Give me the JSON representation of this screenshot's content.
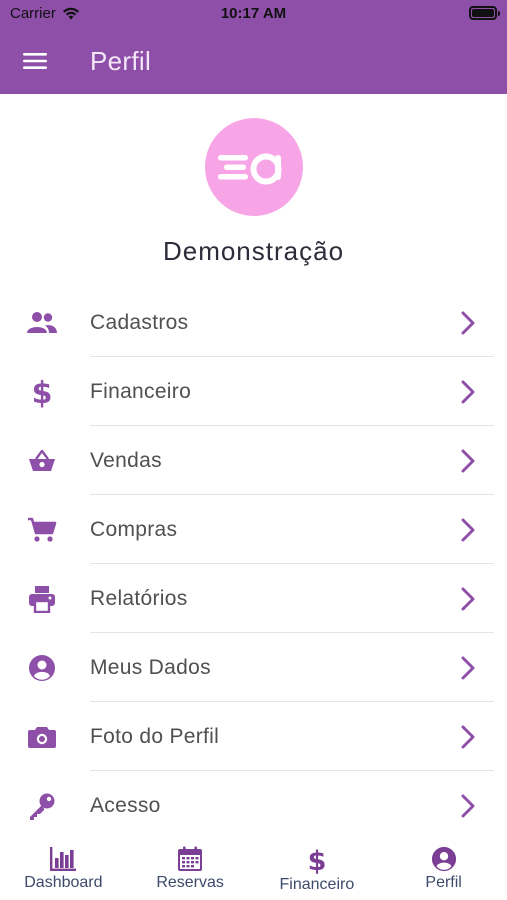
{
  "status_bar": {
    "carrier": "Carrier",
    "time": "10:17 AM"
  },
  "header": {
    "title": "Perfil",
    "menu_icon": "hamburger-icon"
  },
  "profile": {
    "name": "Demonstração",
    "logo_icon": "ea-logo"
  },
  "menu": {
    "items": [
      {
        "label": "Cadastros",
        "icon": "people-icon"
      },
      {
        "label": "Financeiro",
        "icon": "dollar-icon"
      },
      {
        "label": "Vendas",
        "icon": "basket-icon"
      },
      {
        "label": "Compras",
        "icon": "cart-icon"
      },
      {
        "label": "Relatórios",
        "icon": "printer-icon"
      },
      {
        "label": "Meus Dados",
        "icon": "user-circle-icon"
      },
      {
        "label": "Foto do Perfil",
        "icon": "camera-icon"
      },
      {
        "label": "Acesso",
        "icon": "key-icon"
      }
    ]
  },
  "tabbar": {
    "tabs": [
      {
        "label": "Dashboard",
        "icon": "bar-chart-icon"
      },
      {
        "label": "Reservas",
        "icon": "calendar-icon"
      },
      {
        "label": "Financeiro",
        "icon": "dollar-icon"
      },
      {
        "label": "Perfil",
        "icon": "user-circle-icon"
      }
    ]
  },
  "colors": {
    "primary": "#8e4fa8",
    "avatar_bg": "#f7a5e6",
    "icon": "#8e4fa8",
    "tab_icon": "#7a3f95"
  }
}
